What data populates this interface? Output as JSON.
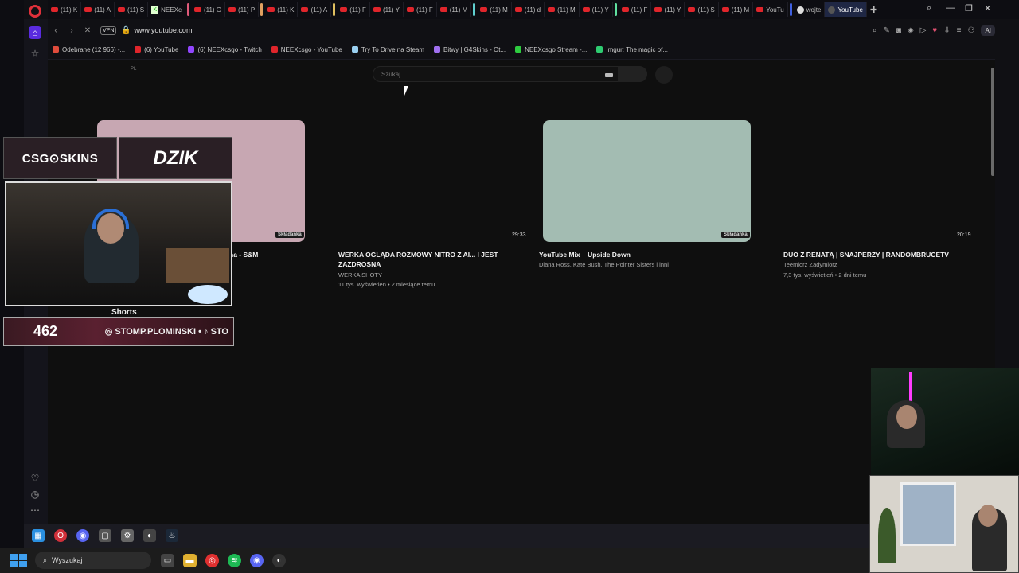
{
  "tabs": [
    {
      "label": "(11) K"
    },
    {
      "label": "(11) A"
    },
    {
      "label": "(11) S"
    },
    {
      "label": "NEEXc",
      "kind": "twitch"
    },
    {
      "label": "(11) G"
    },
    {
      "label": "(11) P"
    },
    {
      "label": "(11) K"
    },
    {
      "label": "(11) A"
    },
    {
      "label": "(11) F"
    },
    {
      "label": "(11) Y"
    },
    {
      "label": "(11) F"
    },
    {
      "label": "(11) M"
    },
    {
      "label": "(11) M"
    },
    {
      "label": "(11) d"
    },
    {
      "label": "(11) M"
    },
    {
      "label": "(11) Y"
    },
    {
      "label": "(11) F"
    },
    {
      "label": "(11) Y"
    },
    {
      "label": "(11) S"
    },
    {
      "label": "(11) M"
    },
    {
      "label": "YouTu"
    },
    {
      "label": "wojte"
    },
    {
      "label": "YouTube",
      "active": true
    }
  ],
  "address": {
    "vpn": "VPN",
    "url": "www.youtube.com",
    "ai": "AI"
  },
  "bookmarks": [
    {
      "label": "Odebrane (12 966) -...",
      "color": "#e04c3c"
    },
    {
      "label": "(6) YouTube",
      "color": "#e0252b"
    },
    {
      "label": "(6) NEEXcsgo - Twitch",
      "color": "#9146ff"
    },
    {
      "label": "NEEXcsgo - YouTube",
      "color": "#e0252b"
    },
    {
      "label": "Try To Drive na Steam",
      "color": "#9ad0f0"
    },
    {
      "label": "Bitwy | G4Skins - Ot...",
      "color": "#a070f0"
    },
    {
      "label": "NEEXcsgo Stream -...",
      "color": "#2ecc40"
    },
    {
      "label": "Imgur: The magic of...",
      "color": "#2ecc71"
    }
  ],
  "youtube": {
    "lang": "PL",
    "search_placeholder": "Szukaj",
    "videos": [
      {
        "title_visible": "na - S&M",
        "badge": "Składanka"
      },
      {
        "title": "WERKA OGLĄDA ROZMOWY NITRO Z AI... I JEST",
        "title2": "ZAZDROSNA",
        "channel": "WERKA SHOTY",
        "meta": "11 tys. wyświetleń • 2 miesiące temu",
        "duration": "29:33"
      },
      {
        "title": "YouTube Mix – Upside Down",
        "channel": "Diana Ross, Kate Bush, The Pointer Sisters i inni",
        "badge": "Składanka"
      },
      {
        "title": "DUO Z RENATĄ | SNAJPERZY | RANDOMBRUCETV",
        "channel": "Teemiorz Zadymiorz",
        "meta": "7,3 tys. wyświetleń • 2 dni temu",
        "duration": "20:19"
      }
    ]
  },
  "overlay": {
    "logo_left": "CSG⊙SKINS",
    "logo_right": "DZIK",
    "shorts": "Shorts",
    "counter": "462",
    "handle": "◎ STOMP.PLOMINSKI • ♪ STO"
  },
  "taskbar": {
    "search": "Wyszukaj"
  }
}
